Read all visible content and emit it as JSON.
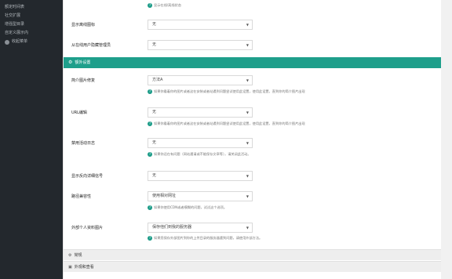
{
  "sidebar": {
    "items": [
      {
        "label": ""
      },
      {
        "label": "额定时间表"
      },
      {
        "label": "社交扩展"
      },
      {
        "label": "增强型目录"
      },
      {
        "label": "自定义展示内"
      }
    ],
    "collapse_label": "收起菜单"
  },
  "top_hint": "显示在线/离线状态",
  "rows_top": [
    {
      "label": "显示离线图标",
      "value": "无"
    },
    {
      "label": "从在线用户隐藏管理员",
      "value": "无"
    }
  ],
  "section": {
    "title": "额外设置",
    "icon": "gears-icon"
  },
  "settings": [
    {
      "label": "简介图片修复",
      "value": "方法A",
      "hint": "如果你看着你的图片或者这在安装或者站遇到问题尝试使用此设置，使用此设置，直到你的简介图片出现"
    },
    {
      "label": "URL编辑",
      "value": "无",
      "hint": "如果你看着你的图片或者这在安装或者站遇到问题尝试使用此设置，使用此设置，直到你的简介图片出现"
    },
    {
      "label": "禁用活动日志",
      "value": "无",
      "hint": "如果你还在有问题（网站遇请或不能保存文章等），请关闭此活动。"
    },
    {
      "label": "显示反向详细信号",
      "value": "无",
      "hint": ""
    },
    {
      "label": "路径兼容性",
      "value": "使用相对网址",
      "hint": "如果你使用CDN或者模糊的问题，试试这个选项。"
    },
    {
      "label": "外部个人资料图片",
      "value": "保存他们到我的服务器",
      "hint": "如果您保存外部图片到你的上传目录的服务器遇到问题，请使用外部方法。"
    }
  ],
  "collapsed_sections": [
    {
      "label": "常规",
      "icon": "gear-icon"
    },
    {
      "label": "外观和查看",
      "icon": "image-icon"
    }
  ]
}
